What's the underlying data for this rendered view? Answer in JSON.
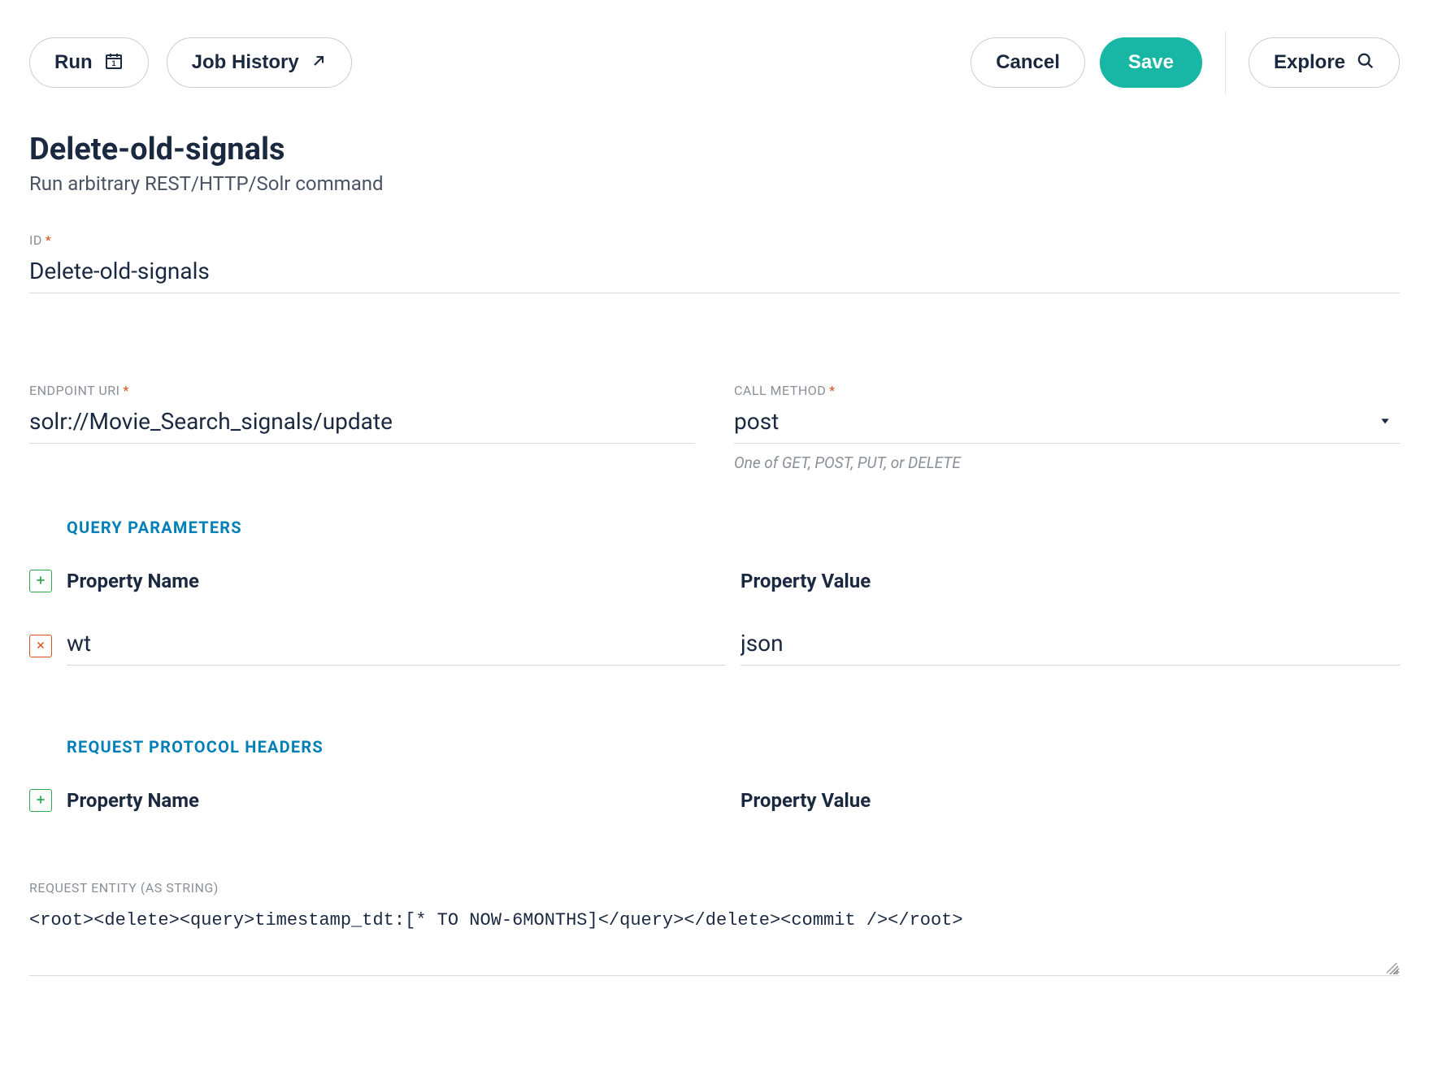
{
  "toolbar": {
    "run_label": "Run",
    "history_label": "Job History",
    "cancel_label": "Cancel",
    "save_label": "Save",
    "explore_label": "Explore"
  },
  "header": {
    "title": "Delete-old-signals",
    "subtitle": "Run arbitrary REST/HTTP/Solr command"
  },
  "fields": {
    "id": {
      "label": "ID",
      "value": "Delete-old-signals",
      "required": true
    },
    "endpoint": {
      "label": "ENDPOINT URI",
      "value": "solr://Movie_Search_signals/update",
      "required": true
    },
    "method": {
      "label": "CALL METHOD",
      "value": "post",
      "required": true,
      "helper": "One of GET, POST, PUT, or DELETE"
    },
    "entity": {
      "label": "REQUEST ENTITY (AS STRING)",
      "value": "<root><delete><query>timestamp_tdt:[* TO NOW-6MONTHS]</query></delete><commit /></root>"
    }
  },
  "sections": {
    "query_params": {
      "heading": "QUERY PARAMETERS",
      "prop_name_header": "Property Name",
      "prop_value_header": "Property Value",
      "rows": [
        {
          "name": "wt",
          "value": "json"
        }
      ]
    },
    "proto_headers": {
      "heading": "REQUEST PROTOCOL HEADERS",
      "prop_name_header": "Property Name",
      "prop_value_header": "Property Value"
    }
  }
}
